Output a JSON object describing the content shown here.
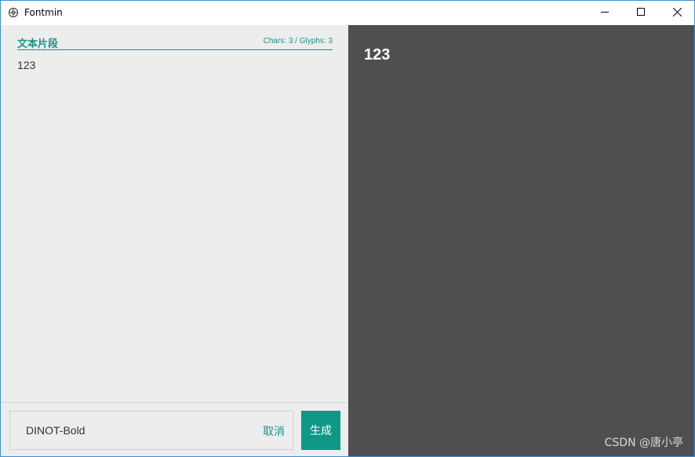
{
  "window": {
    "title": "Fontmin",
    "icons": {
      "app": "fontmin-app-icon",
      "minimize": "minimize-icon",
      "maximize": "maximize-icon",
      "close": "close-icon"
    },
    "accent_color": "#e8613a"
  },
  "editor": {
    "section_title": "文本片段",
    "chars_label": "Chars: 3",
    "separator": " / ",
    "glyphs_label": "Glyphs: 3",
    "text": "123",
    "accent_color": "#159487"
  },
  "footer": {
    "font_name": "DINOT-Bold",
    "cancel_label": "取消",
    "generate_label": "生成",
    "button_color": "#0f9788"
  },
  "preview": {
    "text": "123",
    "background": "#4f4f4f"
  },
  "watermark": "CSDN @唐小亭"
}
